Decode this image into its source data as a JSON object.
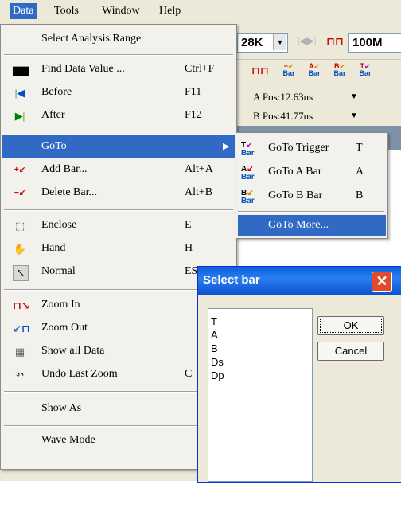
{
  "menubar": {
    "items": [
      {
        "label": "Data",
        "active": true
      },
      {
        "label": "Tools"
      },
      {
        "label": "Window"
      },
      {
        "label": "Help"
      }
    ]
  },
  "toolbar": {
    "sample_rate": "28K",
    "freq": "100M",
    "a_pos": "A Pos:12.63us",
    "b_pos": "B Pos:41.77us",
    "bar_icons": [
      "Bar",
      "Bar",
      "Bar",
      "Bar"
    ]
  },
  "data_menu": {
    "items": [
      {
        "label": "Select Analysis Range",
        "shortcut": ""
      },
      {
        "label": "Find Data Value ...",
        "shortcut": "Ctrl+F",
        "icon": "binoculars-icon"
      },
      {
        "label": "Before",
        "shortcut": "F11",
        "icon": "arrow-left-icon"
      },
      {
        "label": "After",
        "shortcut": "F12",
        "icon": "arrow-right-icon"
      },
      {
        "label": "GoTo",
        "shortcut": "",
        "submenu": true
      },
      {
        "label": "Add Bar...",
        "shortcut": "Alt+A",
        "icon": "add-bar-icon"
      },
      {
        "label": "Delete Bar...",
        "shortcut": "Alt+B",
        "icon": "delete-bar-icon"
      },
      {
        "label": "Enclose",
        "shortcut": "E",
        "icon": "enclose-icon"
      },
      {
        "label": "Hand",
        "shortcut": "H",
        "icon": "hand-icon"
      },
      {
        "label": "Normal",
        "shortcut": "ESC",
        "icon": "pointer-icon"
      },
      {
        "label": "Zoom In",
        "shortcut": "",
        "icon": "zoom-in-icon"
      },
      {
        "label": "Zoom Out",
        "shortcut": "",
        "icon": "zoom-out-icon"
      },
      {
        "label": "Show all Data",
        "shortcut": "",
        "icon": "show-all-icon"
      },
      {
        "label": "Undo Last Zoom",
        "shortcut": "C",
        "icon": "undo-icon"
      },
      {
        "label": "Show As",
        "shortcut": ""
      },
      {
        "label": "Wave Mode",
        "shortcut": ""
      }
    ]
  },
  "goto_submenu": {
    "items": [
      {
        "label": "GoTo Trigger",
        "shortcut": "T",
        "icon_letter": "T"
      },
      {
        "label": "GoTo A Bar",
        "shortcut": "A",
        "icon_letter": "A"
      },
      {
        "label": "GoTo B Bar",
        "shortcut": "B",
        "icon_letter": "B"
      },
      {
        "label": "GoTo More...",
        "shortcut": ""
      }
    ],
    "icon_sub": "Bar"
  },
  "dialog": {
    "title": "Select bar",
    "list": [
      "T",
      "A",
      "B",
      "Ds",
      "Dp"
    ],
    "ok_label": "OK",
    "cancel_label": "Cancel"
  },
  "colors": {
    "highlight": "#316ac5",
    "title_bar": "#0a5fd8",
    "close": "#e04b2c"
  }
}
